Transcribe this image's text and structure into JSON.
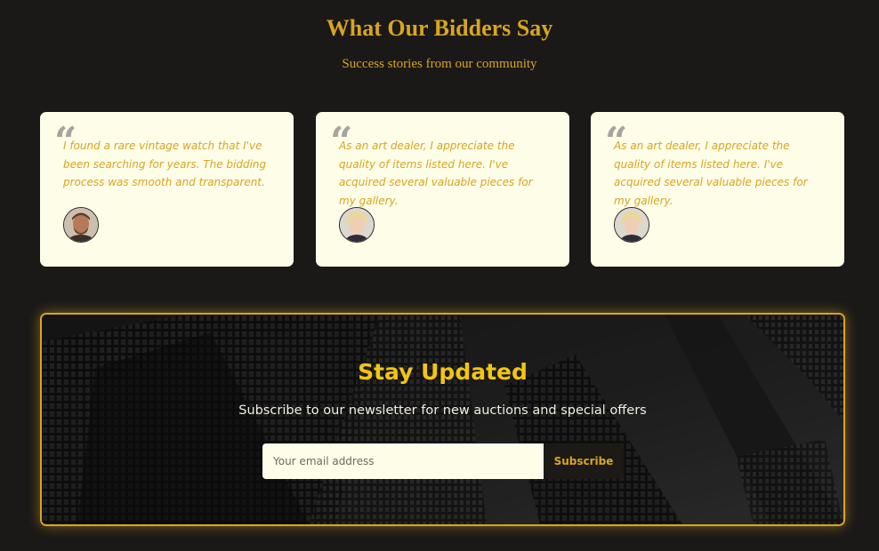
{
  "testimonials": {
    "title": "What Our Bidders Say",
    "subtitle": "Success stories from our community",
    "quote_icon": "quote-left-icon",
    "cards": [
      {
        "text": "I found a rare vintage watch that I've been searching for years. The bidding process was smooth and transparent.",
        "avatar": "avatar-man"
      },
      {
        "text": "As an art dealer, I appreciate the quality of items listed here. I've acquired several valuable pieces for my gallery.",
        "avatar": "avatar-woman"
      },
      {
        "text": "As an art dealer, I appreciate the quality of items listed here. I've acquired several valuable pieces for my gallery.",
        "avatar": "avatar-woman"
      }
    ]
  },
  "newsletter": {
    "title": "Stay Updated",
    "subtitle": "Subscribe to our newsletter for new auctions and special offers",
    "email_placeholder": "Your email address",
    "email_value": "",
    "button_label": "Subscribe"
  },
  "colors": {
    "page_background": "#1a1917",
    "accent_gold": "#d9a520",
    "card_background": "#fdfde8",
    "newsletter_title": "#f2c511"
  }
}
